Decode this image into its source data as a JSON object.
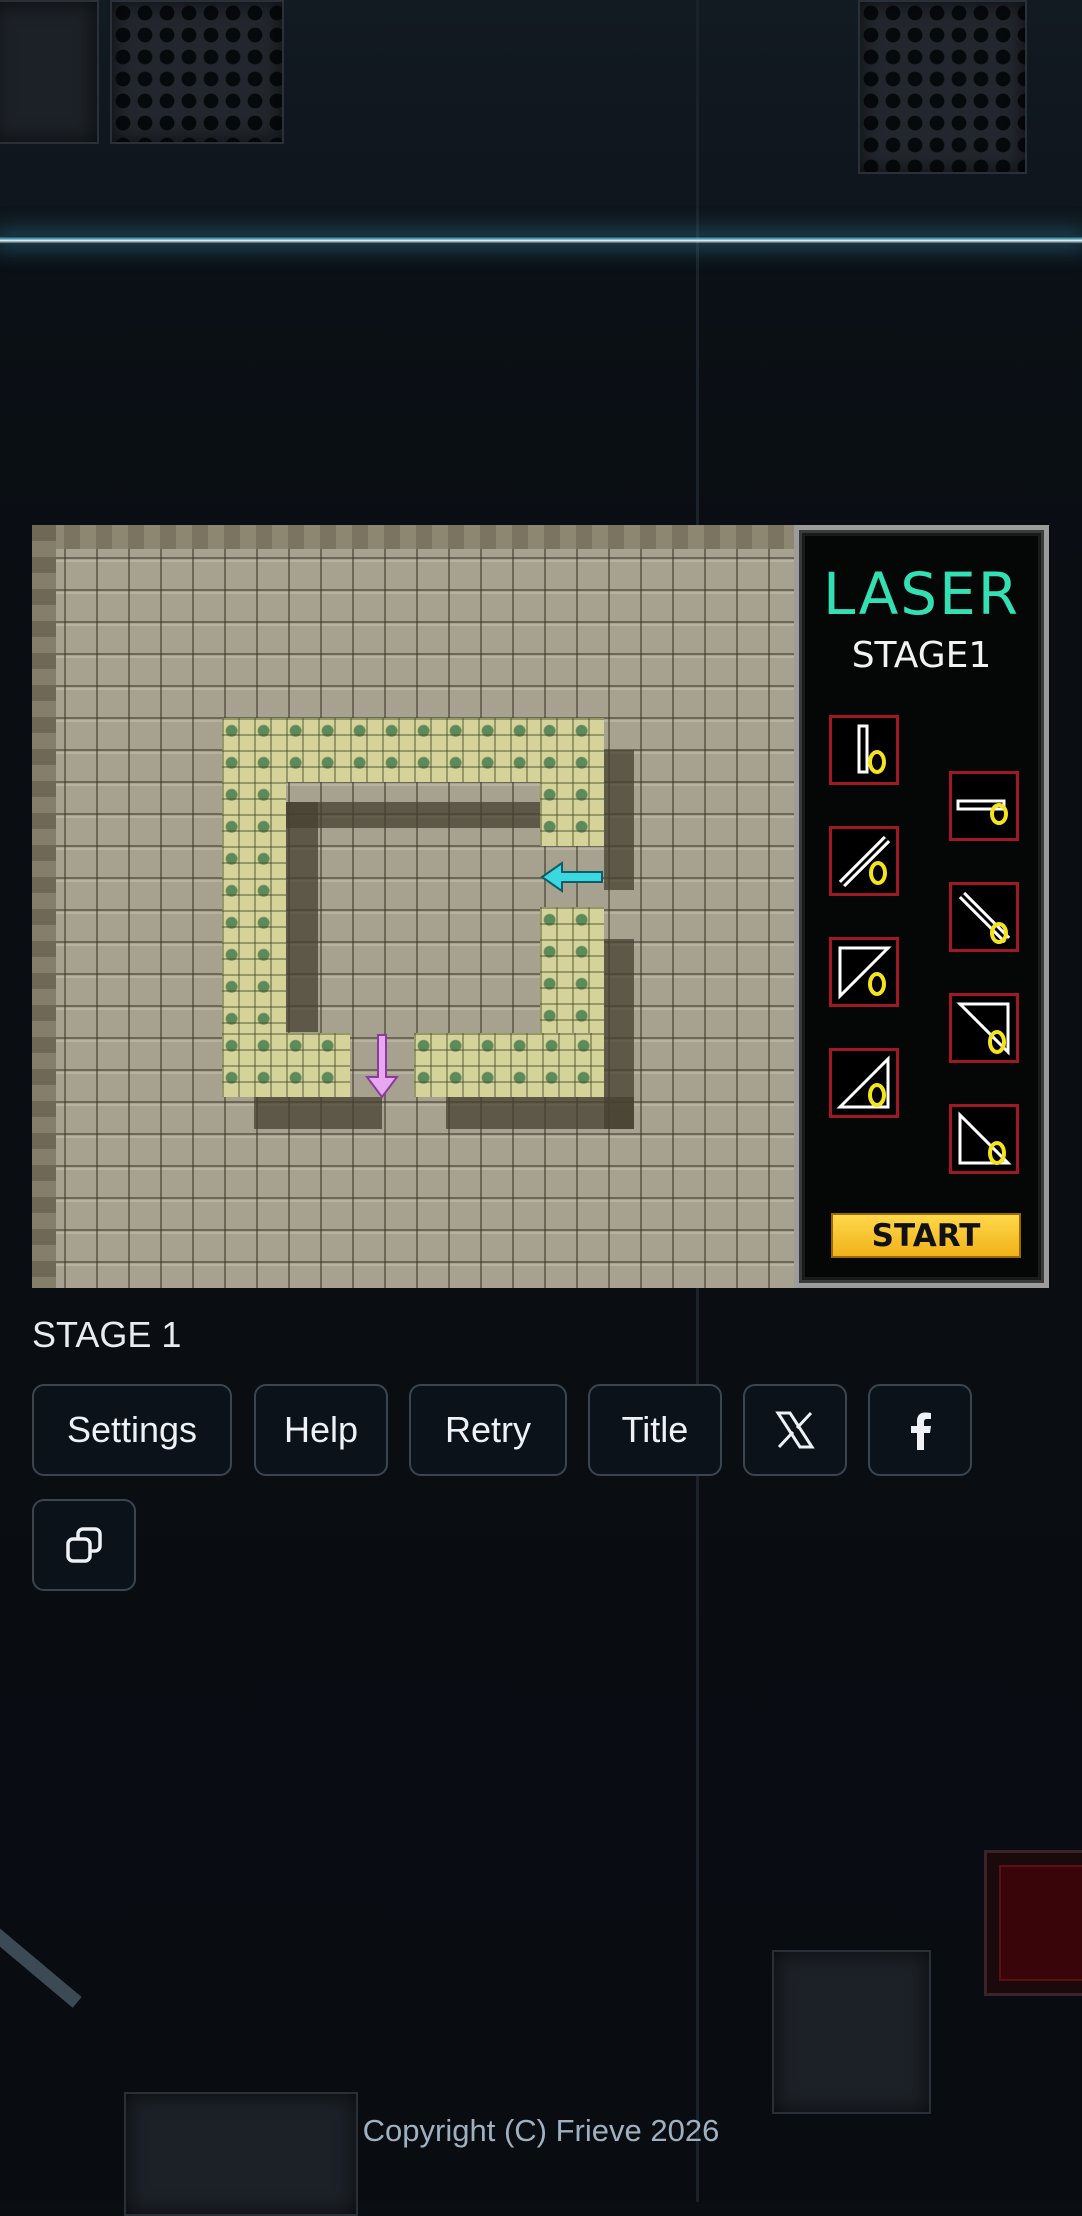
{
  "game": {
    "logo": "LASER",
    "stage_label": "STAGE1",
    "start_label": "START"
  },
  "stage_text": "STAGE 1",
  "buttons": {
    "settings": "Settings",
    "help": "Help",
    "retry": "Retry",
    "title": "Title"
  },
  "icons": {
    "x_share": "x-logo-icon",
    "facebook_share": "facebook-icon",
    "copy": "copy-icon"
  },
  "colors": {
    "logo": "#33e0b4",
    "laser_emitter": "#3ad8e0",
    "laser_target": "#e8a8f0",
    "piece_border": "#a01822",
    "start_button": "#f5c02c"
  },
  "footer": "Copyright (C) Frieve 2026"
}
